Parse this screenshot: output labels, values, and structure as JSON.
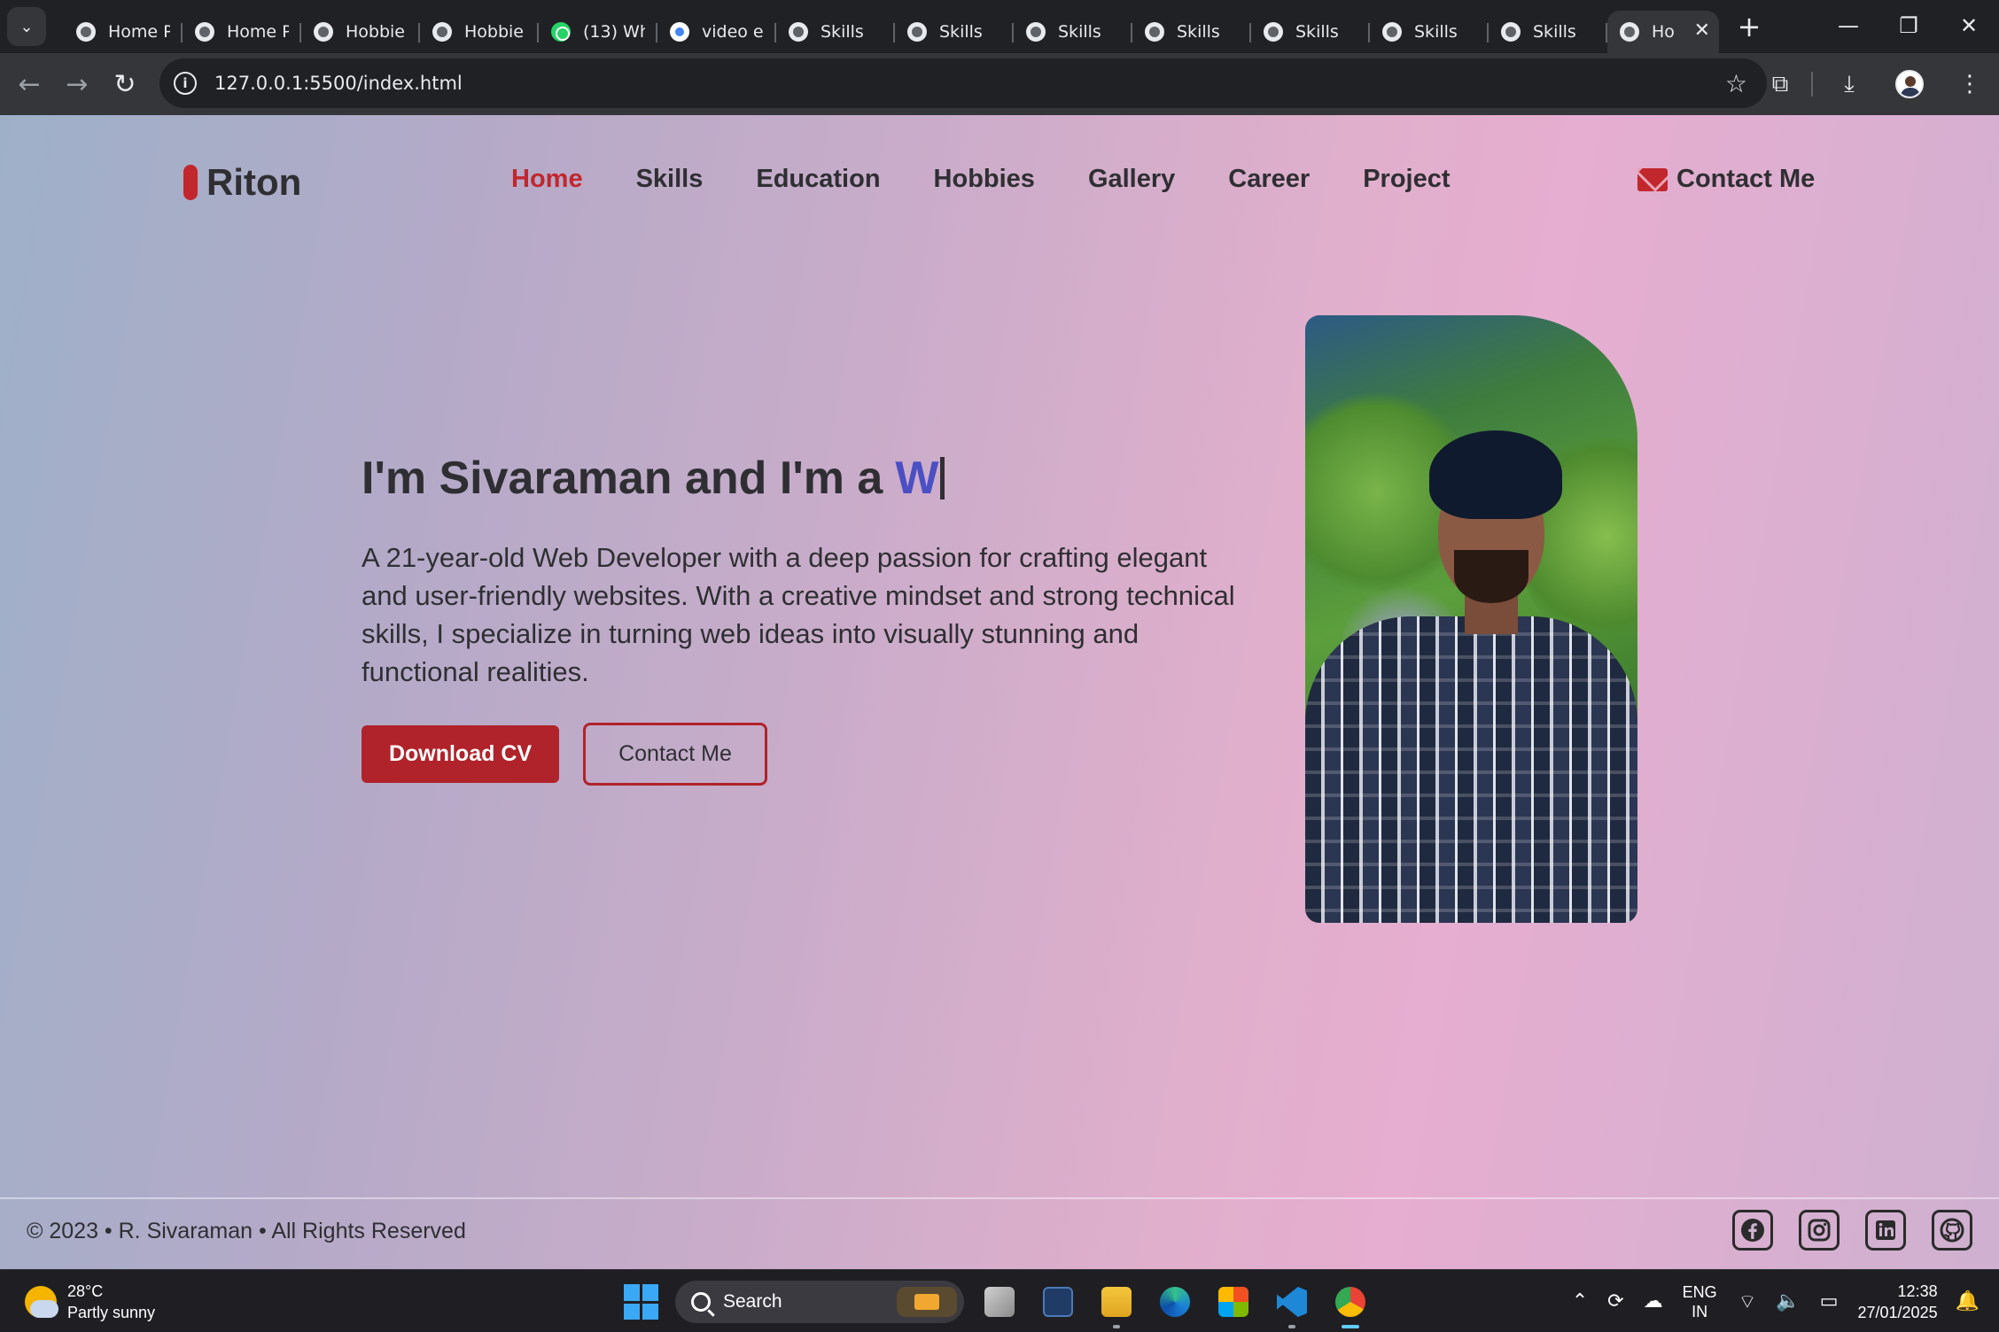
{
  "browser": {
    "tabs": [
      {
        "title": "Home P",
        "icon": "globe-icon"
      },
      {
        "title": "Home P",
        "icon": "globe-icon"
      },
      {
        "title": "Hobbie",
        "icon": "globe-icon"
      },
      {
        "title": "Hobbie",
        "icon": "globe-icon"
      },
      {
        "title": "(13) Wh",
        "icon": "whatsapp-icon"
      },
      {
        "title": "video e",
        "icon": "google-icon"
      },
      {
        "title": "Skills",
        "icon": "globe-icon"
      },
      {
        "title": "Skills",
        "icon": "globe-icon"
      },
      {
        "title": "Skills",
        "icon": "globe-icon"
      },
      {
        "title": "Skills",
        "icon": "globe-icon"
      },
      {
        "title": "Skills",
        "icon": "globe-icon"
      },
      {
        "title": "Skills",
        "icon": "globe-icon"
      },
      {
        "title": "Skills",
        "icon": "globe-icon"
      }
    ],
    "active_tab": {
      "title": "Ho",
      "icon": "globe-icon"
    },
    "url": "127.0.0.1:5500/index.html"
  },
  "site": {
    "logo": "Riton",
    "nav": {
      "home": "Home",
      "skills": "Skills",
      "education": "Education",
      "hobbies": "Hobbies",
      "gallery": "Gallery",
      "career": "Career",
      "project": "Project"
    },
    "contact_link": "Contact Me",
    "hero": {
      "heading": "I'm Sivaraman and I'm a",
      "typed": "W",
      "description": "A 21-year-old Web Developer with a deep passion for crafting elegant and user-friendly websites. With a creative mindset and strong technical skills, I specialize in turning web ideas into visually stunning and functional realities.",
      "download_button": "Download CV",
      "contact_button": "Contact Me"
    },
    "footer": {
      "copyright": "© 2023 • R. Sivaraman • All Rights Reserved",
      "socials": [
        "facebook-icon",
        "instagram-icon",
        "linkedin-icon",
        "github-icon"
      ]
    },
    "colors": {
      "accent": "#b0232a",
      "typed": "#4b4fc4",
      "text": "#2f2f33"
    }
  },
  "taskbar": {
    "weather": {
      "temp": "28°C",
      "desc": "Partly sunny"
    },
    "search_label": "Search",
    "lang": {
      "line1": "ENG",
      "line2": "IN"
    },
    "time": "12:38",
    "date": "27/01/2025"
  }
}
